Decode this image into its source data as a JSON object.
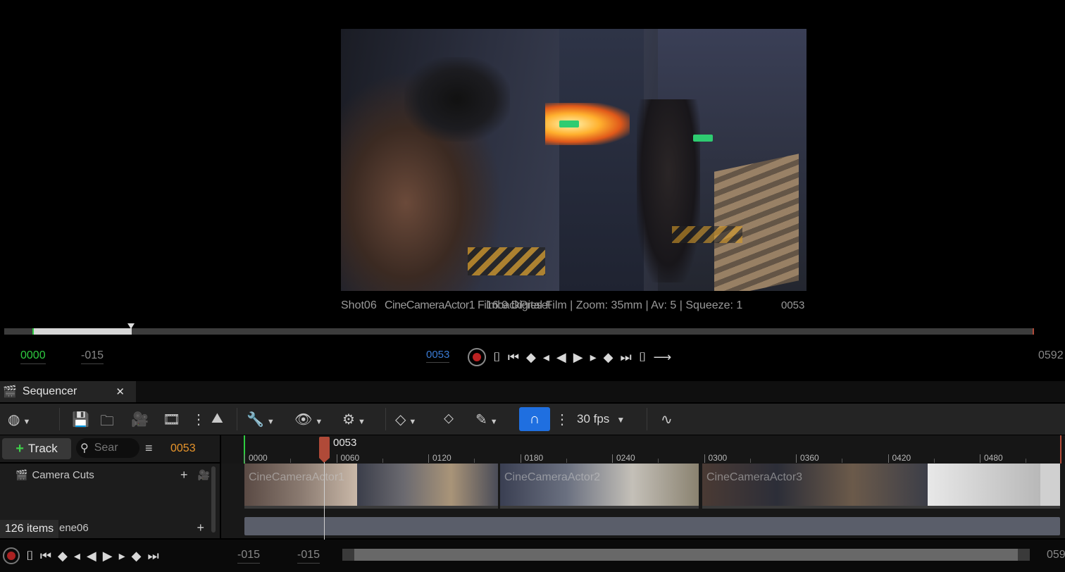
{
  "viewport": {
    "shot_name": "Shot06",
    "camera_info_overlap": "CineCameraActor1 FilmbackPreset",
    "filmback": "16:9 Digital Film | Zoom: 35mm | Av: 5 | Squeeze: 1",
    "frame": "0053",
    "start_time": "0000",
    "in_offset": "-015",
    "current_time": "0053",
    "end_time": "0592"
  },
  "sequencer": {
    "tab_title": "Sequencer",
    "fps": "30 fps",
    "add_track_label": "Track",
    "search_placeholder": "Sear",
    "current_frame": "0053",
    "playhead_label": "0053",
    "ruler_ticks": [
      "0000",
      "0060",
      "0120",
      "0180",
      "0240",
      "0300",
      "0360",
      "0420",
      "0480"
    ],
    "tracks": [
      {
        "label": "Camera Cuts"
      },
      {
        "label": "ene06"
      }
    ],
    "shots": [
      "CineCameraActor1",
      "CineCameraActor2",
      "CineCameraActor3"
    ],
    "items_count": "126 items",
    "bottom_start": "-015",
    "bottom_end": "-015",
    "bottom_right": "059"
  },
  "colors": {
    "accent": "#1f6fe0",
    "start_green": "#2ecc40",
    "current_blue": "#3a7bd5",
    "frame_orange": "#e8952b",
    "playhead": "#b04a38"
  }
}
